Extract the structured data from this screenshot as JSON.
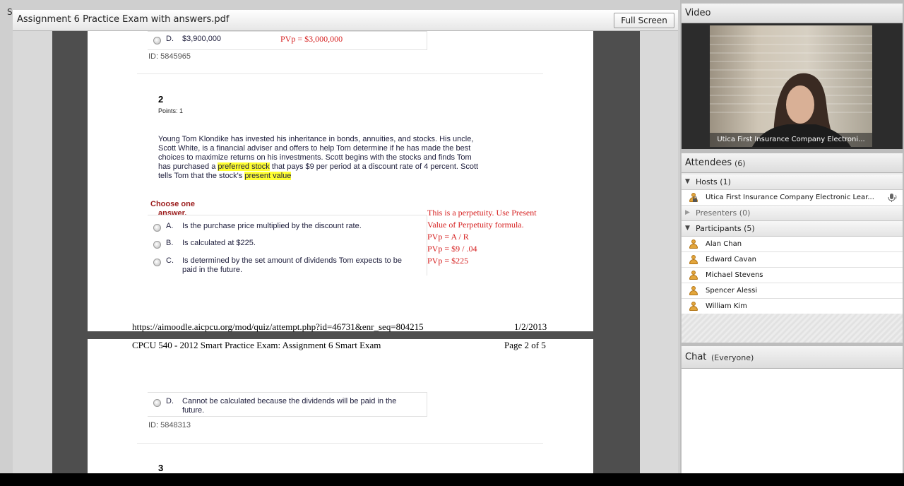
{
  "document_pod": {
    "edge_label": "S",
    "title": "Assignment 6 Practice Exam with answers.pdf",
    "fullscreen_label": "Full Screen"
  },
  "page1": {
    "prev_option_letter": "D.",
    "prev_option_text": "$3,900,000",
    "prev_annotation": "PVp = $3,000,000",
    "prev_id": "ID: 5845965",
    "question_number": "2",
    "points": "Points: 1",
    "question_part1": "Young Tom Klondike has invested his inheritance in bonds, annuities, and stocks. His uncle, Scott White, is a financial adviser and offers to help Tom determine if he has made the best choices to maximize returns on his investments. Scott begins with the stocks and finds Tom has purchased a ",
    "question_hl1": "preferred stock",
    "question_part2": " that pays $9 per period at a discount rate of 4 percent. Scott tells Tom that the stock's ",
    "question_hl2": "present value",
    "choose_line1": "Choose one",
    "choose_line2": "answer.",
    "answers": [
      {
        "letter": "A.",
        "text": "Is the purchase price multiplied by the discount rate."
      },
      {
        "letter": "B.",
        "text": "Is calculated at $225."
      },
      {
        "letter": "C.",
        "text": "Is determined by the set amount of dividends Tom expects to be paid in the future."
      }
    ],
    "annotation_lines": [
      "This is a perpetuity. Use Present",
      "Value of Perpetuity formula.",
      "PVp = A / R",
      "PVp = $9 / .04",
      "PVp = $225"
    ],
    "footer_url": "https://aimoodle.aicpcu.org/mod/quiz/attempt.php?id=46731&enr_seq=804215",
    "footer_date": "1/2/2013"
  },
  "page2": {
    "header_title": "CPCU 540 - 2012 Smart Practice Exam: Assignment 6 Smart Exam",
    "header_page": "Page 2 of 5",
    "option_letter": "D.",
    "option_text": "Cannot be calculated because the dividends will be paid in the future.",
    "id": "ID: 5848313",
    "next_question_number": "3"
  },
  "video": {
    "title": "Video",
    "caption": "Utica First Insurance Company Electroni..."
  },
  "attendees": {
    "title": "Attendees",
    "count": "(6)",
    "hosts_label": "Hosts (1)",
    "host_name": "Utica First Insurance Company Electronic Lear...",
    "presenters_label": "Presenters (0)",
    "participants_label": "Participants (5)",
    "participants": [
      "Alan Chan",
      "Edward Cavan",
      "Michael Stevens",
      "Spencer Alessi",
      "William Kim"
    ]
  },
  "chat": {
    "title": "Chat",
    "scope": "(Everyone)"
  },
  "colors": {
    "annotation": "#d62020",
    "highlight": "#ffff33",
    "choose_label": "#9b1c1c",
    "participant_icon": "#e3a63c"
  }
}
